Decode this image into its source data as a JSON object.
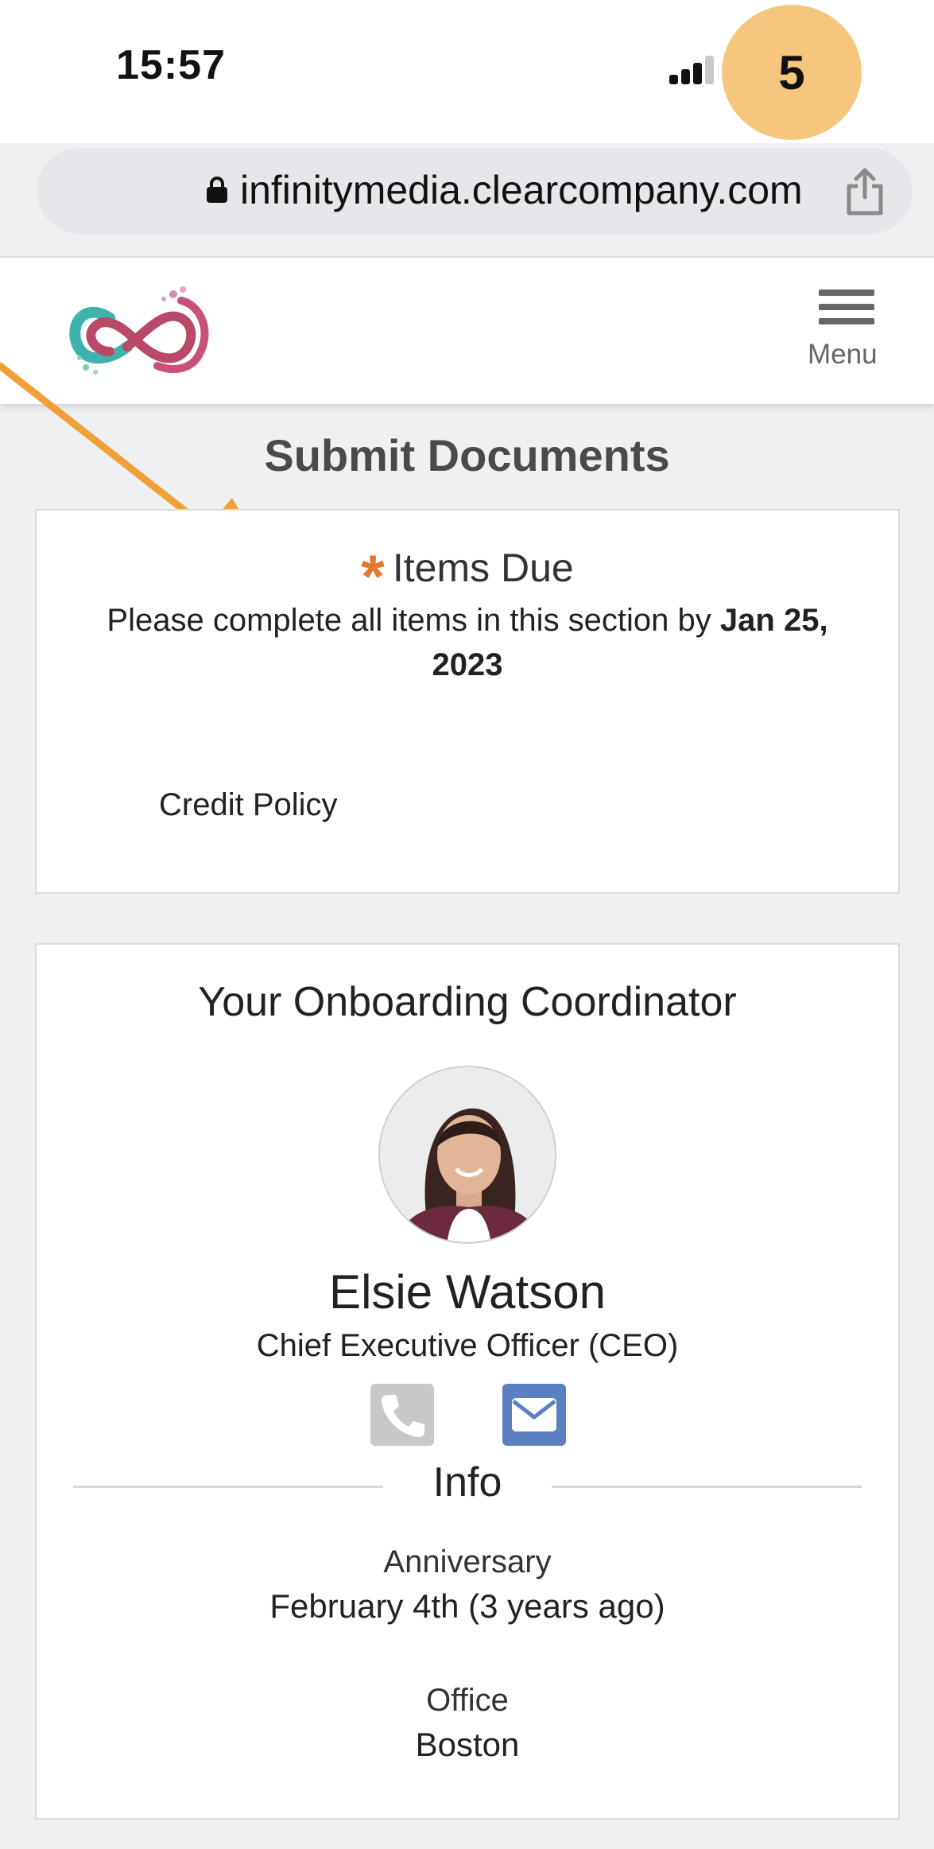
{
  "status_bar": {
    "time": "15:57",
    "badge": "5"
  },
  "browser": {
    "url": "infinitymedia.clearcompany.com"
  },
  "header": {
    "menu_label": "Menu"
  },
  "page": {
    "title": "Submit Documents"
  },
  "items_due": {
    "heading": "Items Due",
    "instruction_prefix": "Please complete all items in this section by",
    "due_date": "Jan 25, 2023",
    "items": [
      "Credit Policy"
    ]
  },
  "coordinator": {
    "heading": "Your Onboarding Coordinator",
    "name": "Elsie Watson",
    "role": "Chief Executive Officer (CEO)",
    "info_heading": "Info",
    "anniversary_label": "Anniversary",
    "anniversary_value": "February 4th (3 years ago)",
    "office_label": "Office",
    "office_value": "Boston"
  },
  "colors": {
    "accent_orange": "#e8772e",
    "badge": "#f6c67e",
    "annotation_arrow": "#f0a038",
    "mail_button": "#5a80c0"
  },
  "icons": [
    "lock-icon",
    "share-icon",
    "hamburger-menu-icon",
    "asterisk-icon",
    "phone-icon",
    "mail-icon",
    "cellular-signal-icon"
  ]
}
